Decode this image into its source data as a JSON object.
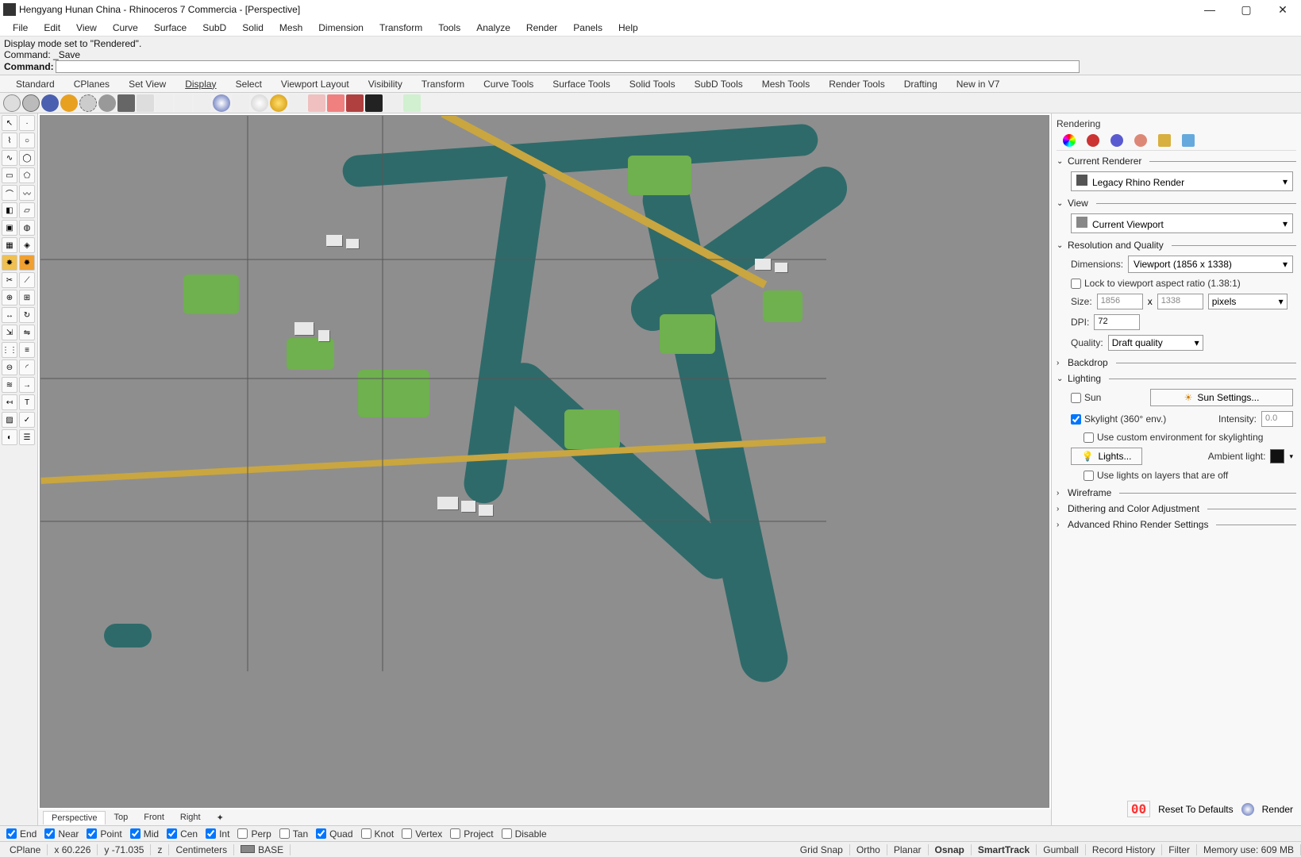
{
  "titlebar": {
    "title": "Hengyang Hunan China - Rhinoceros 7 Commercia - [Perspective]"
  },
  "menu": [
    "File",
    "Edit",
    "View",
    "Curve",
    "Surface",
    "SubD",
    "Solid",
    "Mesh",
    "Dimension",
    "Transform",
    "Tools",
    "Analyze",
    "Render",
    "Panels",
    "Help"
  ],
  "cmd": {
    "line1": "Display mode set to \"Rendered\".",
    "line2_label": "Command:",
    "line2_value": "_Save",
    "prompt": "Command:"
  },
  "tabs": [
    "Standard",
    "CPlanes",
    "Set View",
    "Display",
    "Select",
    "Viewport Layout",
    "Visibility",
    "Transform",
    "Curve Tools",
    "Surface Tools",
    "Solid Tools",
    "SubD Tools",
    "Mesh Tools",
    "Render Tools",
    "Drafting",
    "New in V7"
  ],
  "tabs_active": "Display",
  "viewport": {
    "label": "Perspective"
  },
  "view_tabs": [
    "Perspective",
    "Top",
    "Front",
    "Right"
  ],
  "view_tabs_active": "Perspective",
  "panel": {
    "title": "Rendering",
    "s_renderer": {
      "title": "Current Renderer",
      "value": "Legacy Rhino Render"
    },
    "s_view": {
      "title": "View",
      "value": "Current Viewport"
    },
    "s_res": {
      "title": "Resolution and Quality",
      "dim_label": "Dimensions:",
      "dim_value": "Viewport (1856 x 1338)",
      "lock_label": "Lock to viewport aspect ratio (1.38:1)",
      "size_label": "Size:",
      "w": "1856",
      "x": "x",
      "h": "1338",
      "units": "pixels",
      "dpi_label": "DPI:",
      "dpi": "72",
      "quality_label": "Quality:",
      "quality": "Draft quality"
    },
    "s_backdrop": {
      "title": "Backdrop"
    },
    "s_light": {
      "title": "Lighting",
      "sun": "Sun",
      "sun_btn": "Sun Settings...",
      "skylight": "Skylight (360° env.)",
      "intensity_label": "Intensity:",
      "intensity": "0.0",
      "custom_env": "Use custom environment for skylighting",
      "lights_btn": "Lights...",
      "ambient_label": "Ambient light:",
      "use_lights_off": "Use lights on layers that are off"
    },
    "s_wire": {
      "title": "Wireframe"
    },
    "s_dither": {
      "title": "Dithering and Color Adjustment"
    },
    "s_adv": {
      "title": "Advanced Rhino Render Settings"
    },
    "reset": "Reset To Defaults",
    "render": "Render"
  },
  "osnap": {
    "items": [
      {
        "label": "End",
        "checked": true
      },
      {
        "label": "Near",
        "checked": true
      },
      {
        "label": "Point",
        "checked": true
      },
      {
        "label": "Mid",
        "checked": true
      },
      {
        "label": "Cen",
        "checked": true
      },
      {
        "label": "Int",
        "checked": true
      },
      {
        "label": "Perp",
        "checked": false
      },
      {
        "label": "Tan",
        "checked": false
      },
      {
        "label": "Quad",
        "checked": true
      },
      {
        "label": "Knot",
        "checked": false
      },
      {
        "label": "Vertex",
        "checked": false
      },
      {
        "label": "Project",
        "checked": false
      },
      {
        "label": "Disable",
        "checked": false
      }
    ]
  },
  "status": {
    "cplane": "CPlane",
    "x": "x 60.226",
    "y": "y -71.035",
    "z": "z",
    "units": "Centimeters",
    "layer": "BASE",
    "items": [
      "Grid Snap",
      "Ortho",
      "Planar",
      "Osnap",
      "SmartTrack",
      "Gumball",
      "Record History",
      "Filter",
      "Memory use: 609 MB"
    ],
    "bold": [
      "Osnap",
      "SmartTrack"
    ]
  }
}
